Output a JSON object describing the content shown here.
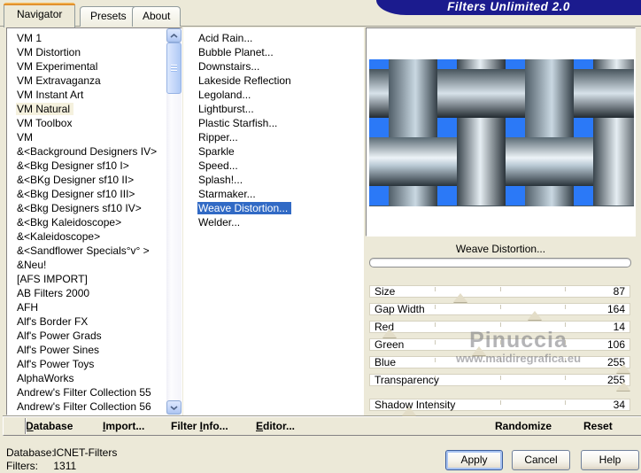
{
  "window": {
    "title": "Filters Unlimited 2.0",
    "tabs": [
      {
        "label": "Navigator",
        "active": true
      },
      {
        "label": "Presets"
      },
      {
        "label": "About"
      }
    ]
  },
  "categories": {
    "selected": "VM Natural",
    "items": [
      "VM 1",
      "VM Distortion",
      "VM Experimental",
      "VM Extravaganza",
      "VM Instant Art",
      {
        "label": "VM Natural",
        "selected": true
      },
      "VM Toolbox",
      "VM",
      "&<Background Designers IV>",
      "&<Bkg Designer sf10 I>",
      "&<BKg Designer sf10 II>",
      "&<Bkg Designer sf10 III>",
      "&<Bkg Designers sf10 IV>",
      "&<Bkg Kaleidoscope>",
      "&<Kaleidoscope>",
      "&<Sandflower Specials°v° >",
      "&Neu!",
      "[AFS IMPORT]",
      "AB Filters 2000",
      "AFH",
      "Alf's Border FX",
      "Alf's Power Grads",
      "Alf's Power Sines",
      "Alf's Power Toys",
      "AlphaWorks",
      "Andrew's Filter Collection 55",
      "Andrew's Filter Collection 56"
    ]
  },
  "filters": {
    "selected": "Weave Distortion...",
    "items": [
      "Acid Rain...",
      "Bubble Planet...",
      "Downstairs...",
      "Lakeside Reflection",
      "Legoland...",
      "Lightburst...",
      "Plastic Starfish...",
      "Ripper...",
      "Sparkle",
      "Speed...",
      "Splash!...",
      "Starmaker...",
      {
        "label": "Weave Distortion...",
        "selected": true
      },
      "Welder..."
    ]
  },
  "preview": {
    "filter_name": "Weave Distortion...",
    "progress_percent": 0,
    "weave_blue": "#2B79F7"
  },
  "parameters": [
    {
      "label": "Size",
      "value": 87
    },
    {
      "label": "Gap Width",
      "value": 164
    },
    {
      "label": "Red",
      "value": 14
    },
    {
      "label": "Green",
      "value": 106
    },
    {
      "label": "Blue",
      "value": 255
    },
    {
      "label": "Transparency",
      "value": 255
    },
    {
      "label": "Shadow Intensity",
      "value": 34,
      "gap_before": true
    }
  ],
  "watermark": {
    "line1": "Pinuccia",
    "line2": "www.maidiregrafica.eu"
  },
  "toolbar": {
    "items": [
      {
        "label": "Database",
        "pre": "",
        "accel": "D",
        "post": "atabase"
      },
      {
        "label": "Import...",
        "pre": "",
        "accel": "I",
        "post": "mport..."
      },
      {
        "label": "Filter Info...",
        "pre": "Filter ",
        "accel": "I",
        "post": "nfo..."
      },
      {
        "label": "Editor...",
        "pre": "",
        "accel": "E",
        "post": "ditor..."
      },
      {
        "label": "Randomize",
        "pre": "Randomize",
        "accel": "",
        "post": ""
      },
      {
        "label": "Reset",
        "pre": "Reset",
        "accel": "",
        "post": ""
      }
    ]
  },
  "status": {
    "rows": [
      {
        "label": "Database:",
        "value": "ICNET-Filters"
      },
      {
        "label": "Filters:",
        "value": "1311"
      }
    ]
  },
  "action_buttons": [
    {
      "label": "Apply",
      "focused": true
    },
    {
      "label": "Cancel"
    },
    {
      "label": "Help"
    }
  ],
  "colors": {
    "background_beige": "#ECE9D8",
    "banner_navy": "#1B1B8E",
    "selection_blue": "#316AC5",
    "inactive_selection_cream": "#F5F1DE",
    "tab_accent_orange": "#E8A33D"
  }
}
